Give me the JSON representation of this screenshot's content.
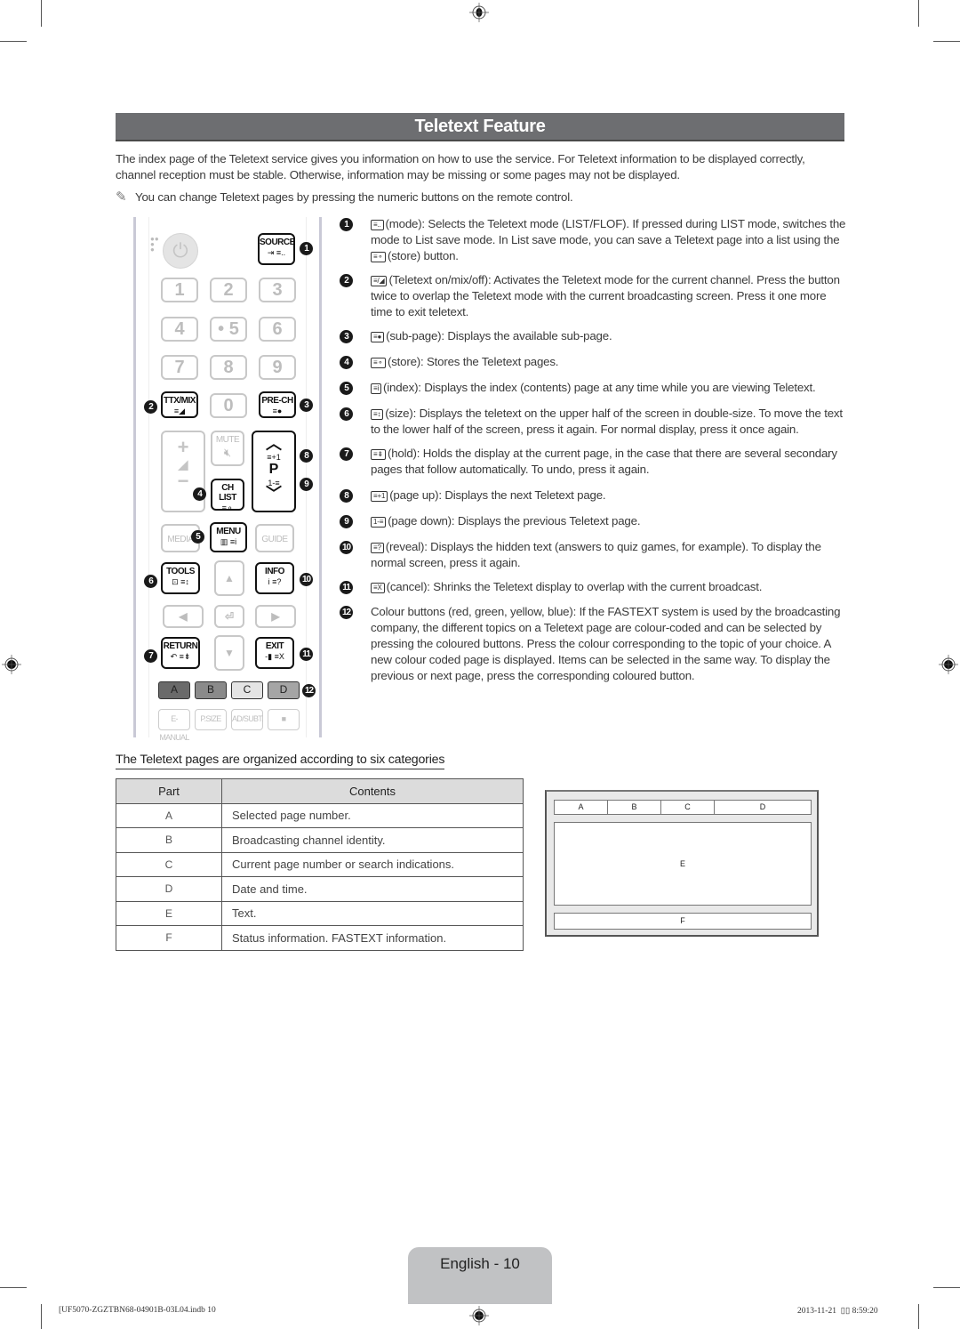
{
  "title": "Teletext Feature",
  "intro": "The index page of the Teletext service gives you information on how to use the service. For Teletext information to be displayed correctly, channel reception must be stable. Otherwise, information may be missing or some pages may not be displayed.",
  "note": "You can change Teletext pages by pressing the numeric buttons on the remote control.",
  "remote": {
    "source": "SOURCE",
    "numbers": [
      "1",
      "2",
      "3",
      "4",
      "• 5",
      "6",
      "7",
      "8",
      "9",
      "0"
    ],
    "ttx_mix": "TTX/MIX",
    "pre_ch": "PRE-CH",
    "mute": "MUTE",
    "ch_list": "CH LIST",
    "p": "P",
    "media": "MEDIA",
    "menu": "MENU",
    "guide": "GUIDE",
    "tools": "TOOLS",
    "info": "INFO",
    "return": "RETURN",
    "exit": "EXIT",
    "colors": [
      "A",
      "B",
      "C",
      "D"
    ],
    "bottom": [
      "E-MANUAL",
      "P.SIZE",
      "AD/SUBT.",
      "■"
    ],
    "callouts": [
      "1",
      "2",
      "3",
      "4",
      "5",
      "6",
      "7",
      "8",
      "9",
      "10",
      "11",
      "12"
    ]
  },
  "descriptions": [
    {
      "n": "1",
      "icon": "≡..",
      "text": "(mode): Selects the Teletext mode (LIST/FLOF). If pressed during LIST mode, switches the mode to List save mode. In List save mode, you can save a Teletext page into a list using the ",
      "icon2": "≡⚬",
      "text2": "(store) button."
    },
    {
      "n": "2",
      "icon": "≡/◢",
      "text": "(Teletext on/mix/off): Activates the Teletext mode for the current channel. Press the button twice to overlap the Teletext mode with the current broadcasting screen. Press it one more time to exit teletext."
    },
    {
      "n": "3",
      "icon": "≡●",
      "text": "(sub-page): Displays the available sub-page."
    },
    {
      "n": "4",
      "icon": "≡⚬",
      "text": "(store): Stores the Teletext pages."
    },
    {
      "n": "5",
      "icon": "≡i",
      "text": "(index): Displays the index (contents) page at any time while you are viewing Teletext."
    },
    {
      "n": "6",
      "icon": "≡↕",
      "text": "(size): Displays the teletext on the upper half of the screen in double-size. To move the text to the lower half of the screen, press it again. For normal display, press it once again."
    },
    {
      "n": "7",
      "icon": "≡⇟",
      "text": "(hold): Holds the display at the current page, in the case that there are several secondary pages that follow automatically. To undo, press it again."
    },
    {
      "n": "8",
      "icon": "≡+1",
      "text": "(page up): Displays the next Teletext page."
    },
    {
      "n": "9",
      "icon": "1-≡",
      "text": "(page down): Displays the previous Teletext page."
    },
    {
      "n": "10",
      "icon": "≡?",
      "text": "(reveal): Displays the hidden text (answers to quiz games, for example). To display the normal screen, press it again."
    },
    {
      "n": "11",
      "icon": "≡X",
      "text": "(cancel): Shrinks the Teletext display to overlap with the current broadcast."
    },
    {
      "n": "12",
      "icon": "",
      "text": "Colour buttons (red, green, yellow, blue): If the FASTEXT system is used by the broadcasting company, the different topics on a Teletext page are colour-coded and can be selected by pressing the coloured buttons. Press the colour corresponding to the topic of your choice. A new colour coded page is displayed. Items can be selected in the same way. To display the previous or next page, press the corresponding coloured button."
    }
  ],
  "categories_heading": "The Teletext pages are organized according to six categories",
  "table": {
    "headers": [
      "Part",
      "Contents"
    ],
    "rows": [
      [
        "A",
        "Selected page number."
      ],
      [
        "B",
        "Broadcasting channel identity."
      ],
      [
        "C",
        "Current page number or search indications."
      ],
      [
        "D",
        "Date and time."
      ],
      [
        "E",
        "Text."
      ],
      [
        "F",
        "Status information. FASTEXT information."
      ]
    ]
  },
  "diagram": {
    "top": [
      "A",
      "B",
      "C",
      "D"
    ],
    "middle": "E",
    "bottom": "F"
  },
  "page_label": "English - 10",
  "footer": {
    "file": "[UF5070-ZGZTBN68-04901B-03L04.indb   10",
    "date": "2013-11-21",
    "time": "8:59:20"
  }
}
